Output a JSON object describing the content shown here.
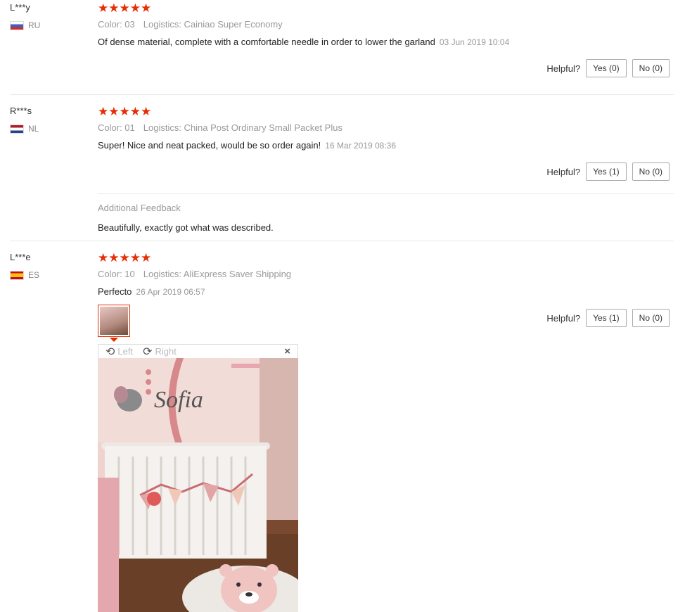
{
  "reviews": [
    {
      "user": "L***y",
      "country": "RU",
      "stars": "★★★★★",
      "color": "Color: 03",
      "logistics": "Logistics: Cainiao Super Economy",
      "text": "Of dense material, complete with a comfortable needle in order to lower the garland",
      "date": "03 Jun 2019 10:04",
      "helpful_label": "Helpful?",
      "yes": "Yes (0)",
      "no": "No (0)"
    },
    {
      "user": "R***s",
      "country": "NL",
      "stars": "★★★★★",
      "color": "Color: 01",
      "logistics": "Logistics: China Post Ordinary Small Packet Plus",
      "text": "Super! Nice and neat packed, would be so order again!",
      "date": "16 Mar 2019 08:36",
      "helpful_label": "Helpful?",
      "yes": "Yes (1)",
      "no": "No (0)",
      "additional_label": "Additional Feedback",
      "additional_text": "Beautifully, exactly got what was described."
    },
    {
      "user": "L***e",
      "country": "ES",
      "stars": "★★★★★",
      "color": "Color: 10",
      "logistics": "Logistics: AliExpress Saver Shipping",
      "text": "Perfecto",
      "date": "26 Apr 2019 06:57",
      "helpful_label": "Helpful?",
      "yes": "Yes (1)",
      "no": "No (0)"
    }
  ],
  "viewer": {
    "left_label": "Left",
    "right_label": "Right",
    "close": "×",
    "wall_text": "Sofia"
  },
  "colors": {
    "star": "#e62e04",
    "accent": "#e62e04"
  }
}
